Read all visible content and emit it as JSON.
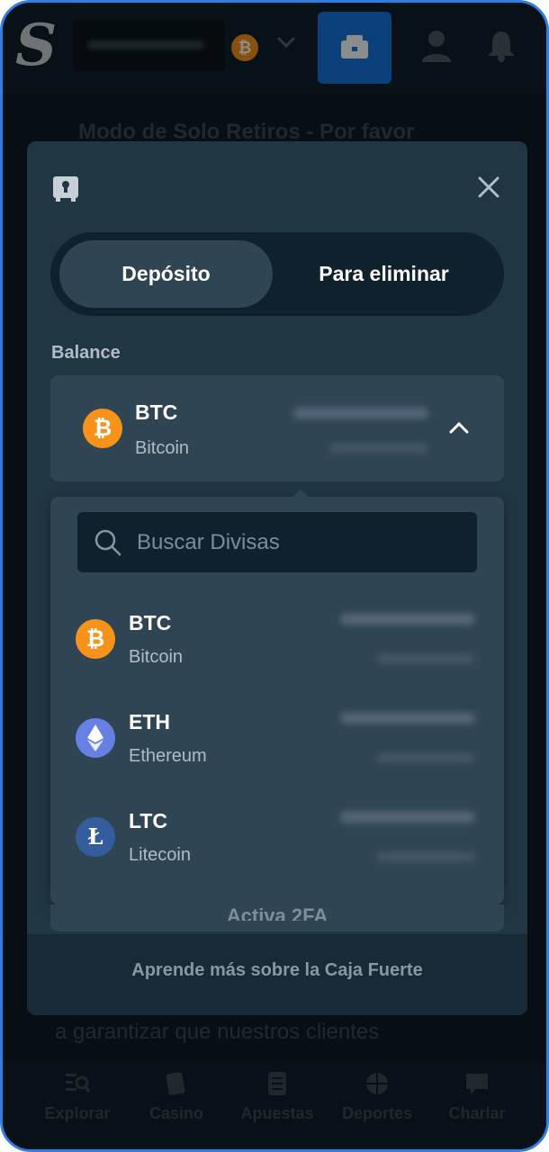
{
  "header": {
    "logo_text": "S"
  },
  "background": {
    "banner_text": "Modo de Solo Retiros - Por favor",
    "body_text": "a garantizar que nuestros clientes"
  },
  "bottom_nav": {
    "items": [
      {
        "label": "Explorar",
        "icon": "search-list-icon"
      },
      {
        "label": "Casino",
        "icon": "cards-icon"
      },
      {
        "label": "Apuestas",
        "icon": "betslip-icon"
      },
      {
        "label": "Deportes",
        "icon": "basketball-icon"
      },
      {
        "label": "Charlar",
        "icon": "chat-icon"
      }
    ]
  },
  "modal": {
    "tabs": [
      {
        "label": "Depósito",
        "active": true
      },
      {
        "label": "Para eliminar",
        "active": false
      }
    ],
    "balance_label": "Balance",
    "selected_currency": {
      "code": "BTC",
      "name": "Bitcoin",
      "icon": "bitcoin-icon"
    },
    "search": {
      "placeholder": "Buscar Divisas"
    },
    "currencies": [
      {
        "code": "BTC",
        "name": "Bitcoin",
        "icon": "bitcoin-icon",
        "color": "#f7931a"
      },
      {
        "code": "ETH",
        "name": "Ethereum",
        "icon": "ethereum-icon",
        "color": "#6680e3"
      },
      {
        "code": "LTC",
        "name": "Litecoin",
        "icon": "litecoin-icon",
        "color": "#345d9d"
      }
    ],
    "twofa_text": "Activa 2FA",
    "learn_more": "Aprende más sobre la Caja Fuerte"
  },
  "colors": {
    "accent": "#1475e1",
    "modal_bg": "#213643",
    "surface": "#2f4553",
    "input_bg": "#0f212c"
  }
}
